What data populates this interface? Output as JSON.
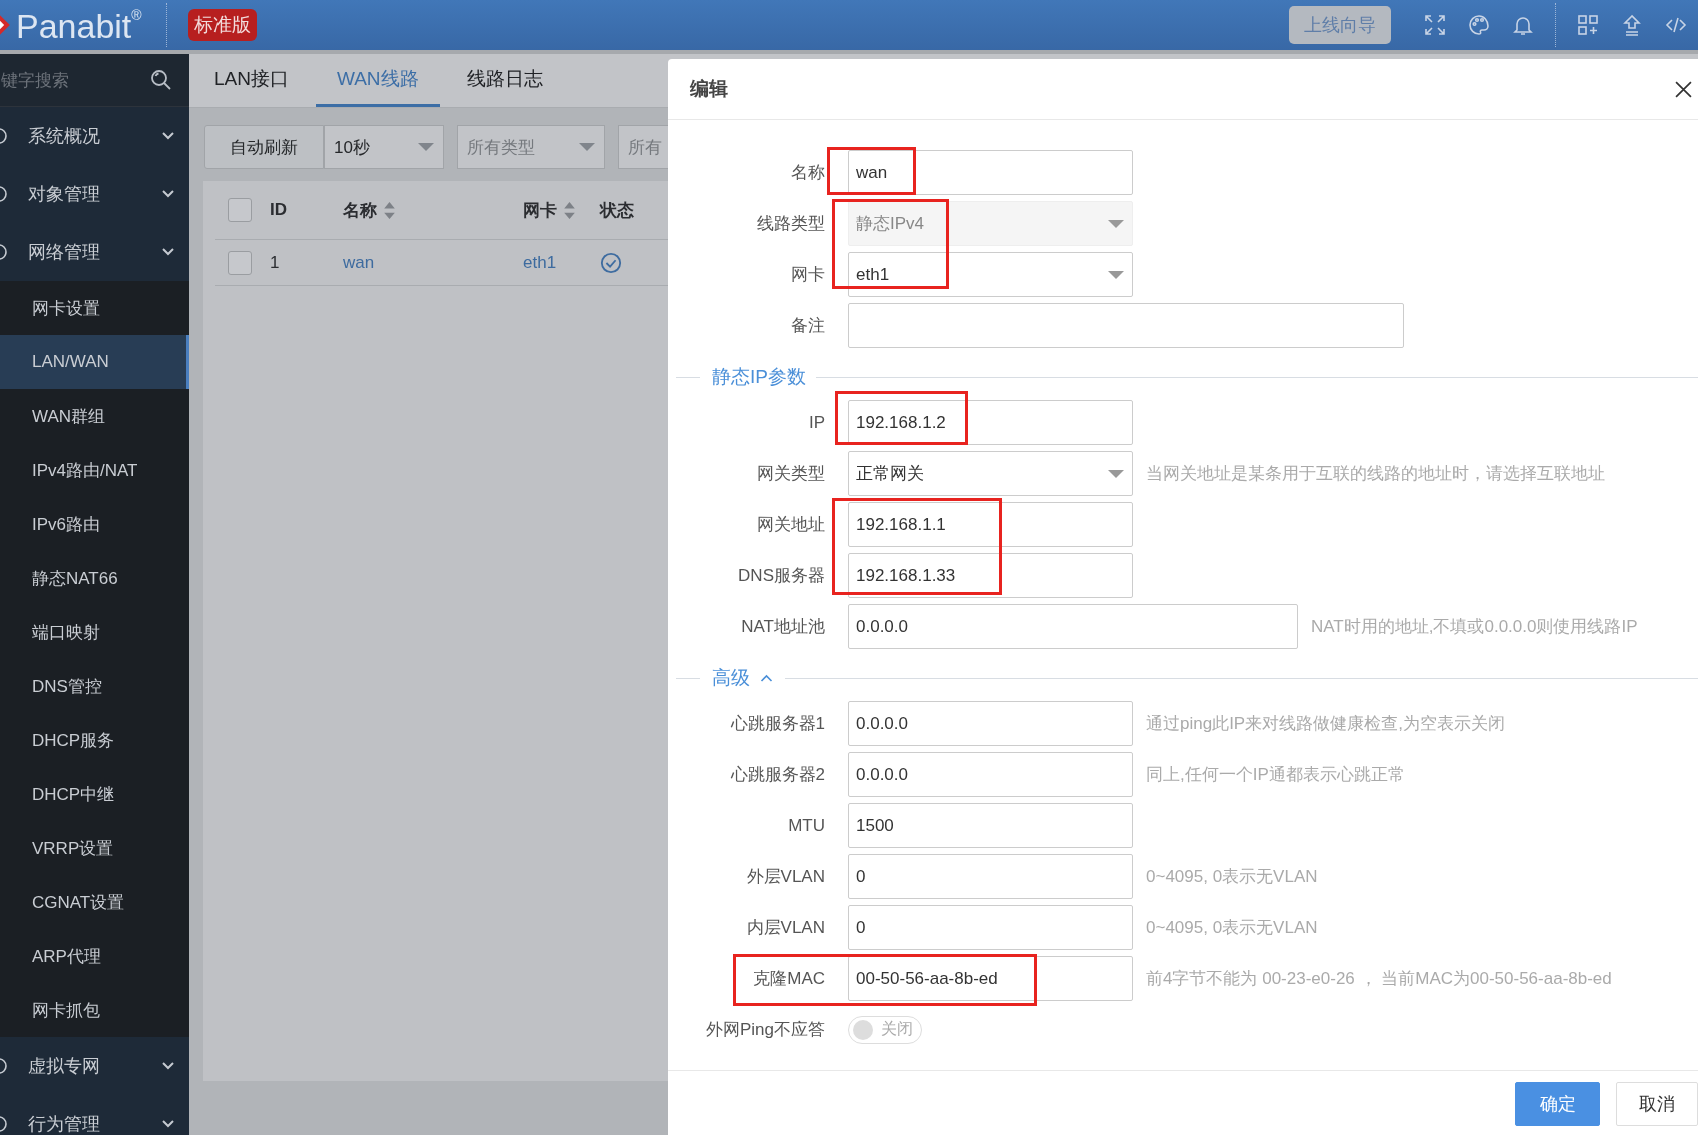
{
  "topbar": {
    "logo": "Panabit",
    "logo_mark": "®",
    "edition": "标准版",
    "wizard_button": "上线向导"
  },
  "sidebar": {
    "search": {
      "placeholder": "键字搜索"
    },
    "groups": [
      {
        "label": "系统概况"
      },
      {
        "label": "对象管理"
      },
      {
        "label": "网络管理",
        "children": [
          {
            "label": "网卡设置",
            "selected": false
          },
          {
            "label": "LAN/WAN",
            "selected": true
          },
          {
            "label": "WAN群组",
            "selected": false
          },
          {
            "label": "IPv4路由/NAT",
            "selected": false
          },
          {
            "label": "IPv6路由",
            "selected": false
          },
          {
            "label": "静态NAT66",
            "selected": false
          },
          {
            "label": "端口映射",
            "selected": false
          },
          {
            "label": "DNS管控",
            "selected": false
          },
          {
            "label": "DHCP服务",
            "selected": false
          },
          {
            "label": "DHCP中继",
            "selected": false
          },
          {
            "label": "VRRP设置",
            "selected": false
          },
          {
            "label": "CGNAT设置",
            "selected": false
          },
          {
            "label": "ARP代理",
            "selected": false
          },
          {
            "label": "网卡抓包",
            "selected": false
          }
        ]
      },
      {
        "label": "虚拟专网"
      },
      {
        "label": "行为管理"
      }
    ]
  },
  "tabs": [
    {
      "label": "LAN接口",
      "selected": false
    },
    {
      "label": "WAN线路",
      "selected": true
    },
    {
      "label": "线路日志",
      "selected": false
    }
  ],
  "toolbar": {
    "refresh_button": "自动刷新",
    "selects": [
      {
        "value": "10秒"
      },
      {
        "placeholder": "所有类型"
      },
      {
        "placeholder": "所有"
      }
    ]
  },
  "table": {
    "header_checked": false,
    "columns": [
      {
        "label": "ID",
        "sortable": false
      },
      {
        "label": "名称",
        "sortable": true
      },
      {
        "label": "网卡",
        "sortable": true
      },
      {
        "label": "状态",
        "sortable": false
      }
    ],
    "rows": [
      {
        "checked": false,
        "id": "1",
        "name": "wan",
        "nic": "eth1",
        "enabled": true
      }
    ]
  },
  "dialog": {
    "title": "编辑",
    "sections": [
      {
        "fields": [
          {
            "label": "名称",
            "kind": "text",
            "value": "wan",
            "disabled": false
          },
          {
            "label": "线路类型",
            "kind": "select",
            "value": "静态IPv4",
            "disabled": true
          },
          {
            "label": "网卡",
            "kind": "select",
            "value": "eth1",
            "disabled": false
          },
          {
            "label": "备注",
            "kind": "text",
            "disabled": false
          }
        ]
      },
      {
        "title": "静态IP参数",
        "fields": [
          {
            "label": "IP",
            "kind": "text",
            "value": "192.168.1.2",
            "disabled": false
          },
          {
            "label": "网关类型",
            "kind": "select",
            "value": "正常网关",
            "disabled": false,
            "hint": "当网关地址是某条用于互联的线路的地址时，请选择互联地址"
          },
          {
            "label": "网关地址",
            "kind": "text",
            "value": "192.168.1.1",
            "disabled": false
          },
          {
            "label": "DNS服务器",
            "kind": "text",
            "value": "192.168.1.33",
            "disabled": false
          },
          {
            "label": "NAT地址池",
            "kind": "text",
            "value": "0.0.0.0",
            "disabled": false,
            "hint": "NAT时用的地址,不填或0.0.0.0则使用线路IP"
          }
        ]
      },
      {
        "title": "高级",
        "expanded": true,
        "fields": [
          {
            "label": "心跳服务器1",
            "kind": "text",
            "value": "0.0.0.0",
            "disabled": false,
            "hint": "通过ping此IP来对线路做健康检查,为空表示关闭"
          },
          {
            "label": "心跳服务器2",
            "kind": "text",
            "value": "0.0.0.0",
            "disabled": false,
            "hint": "同上,任何一个IP通都表示心跳正常"
          },
          {
            "label": "MTU",
            "kind": "text",
            "value": "1500",
            "disabled": false
          },
          {
            "label": "外层VLAN",
            "kind": "text",
            "value": "0",
            "disabled": false,
            "hint": "0~4095, 0表示无VLAN"
          },
          {
            "label": "内层VLAN",
            "kind": "text",
            "value": "0",
            "disabled": false,
            "hint": "0~4095, 0表示无VLAN"
          },
          {
            "label": "克隆MAC",
            "kind": "text",
            "value": "00-50-56-aa-8b-ed",
            "disabled": false,
            "hint": "前4字节不能为 00-23-e0-26 ， 当前MAC为00-50-56-aa-8b-ed"
          },
          {
            "label": "外网Ping不应答",
            "kind": "switch",
            "on": false,
            "state_text": "关闭",
            "disabled": false
          }
        ]
      }
    ],
    "annotations": [
      {
        "kind": "highlight"
      },
      {
        "kind": "highlight"
      },
      {
        "kind": "highlight"
      },
      {
        "kind": "highlight"
      },
      {
        "kind": "highlight"
      }
    ],
    "buttons": [
      {
        "label": "确定",
        "kind": "primary"
      },
      {
        "label": "取消",
        "kind": "default"
      }
    ]
  }
}
